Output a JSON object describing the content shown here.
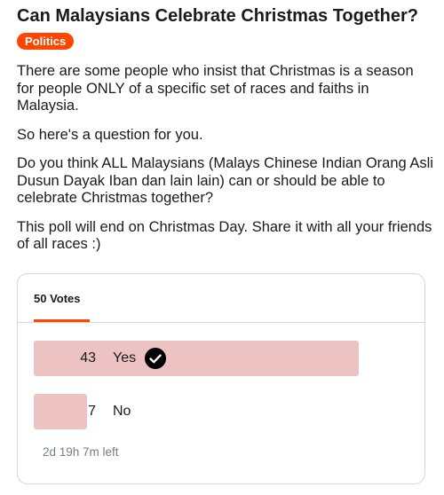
{
  "post": {
    "title": "Can Malaysians Celebrate Christmas Together?",
    "flair": "Politics",
    "paragraphs": [
      "There are some people who insist that Christmas is a season for people ONLY of a specific set of races and faiths in Malaysia.",
      "So here's a question for you.",
      "Do you think ALL Malaysians (Malays Chinese Indian Orang Asli Dusun Dayak Iban dan lain lain) can or should be able to celebrate Christmas together?",
      "This poll will end on Christmas Day. Share it with all your friends of all races :)"
    ]
  },
  "poll": {
    "total_votes": "50 Votes",
    "options": [
      {
        "count": "43",
        "label": "Yes",
        "votes": 43,
        "selected": true,
        "icon": "check-circle-icon"
      },
      {
        "count": "7",
        "label": "No",
        "votes": 7,
        "selected": false
      }
    ],
    "time_left": "2d 19h 7m left"
  },
  "colors": {
    "flair_bg": "#ff4500",
    "result_bar": "#ecc2c2",
    "tab_underline": "#ff4500"
  }
}
